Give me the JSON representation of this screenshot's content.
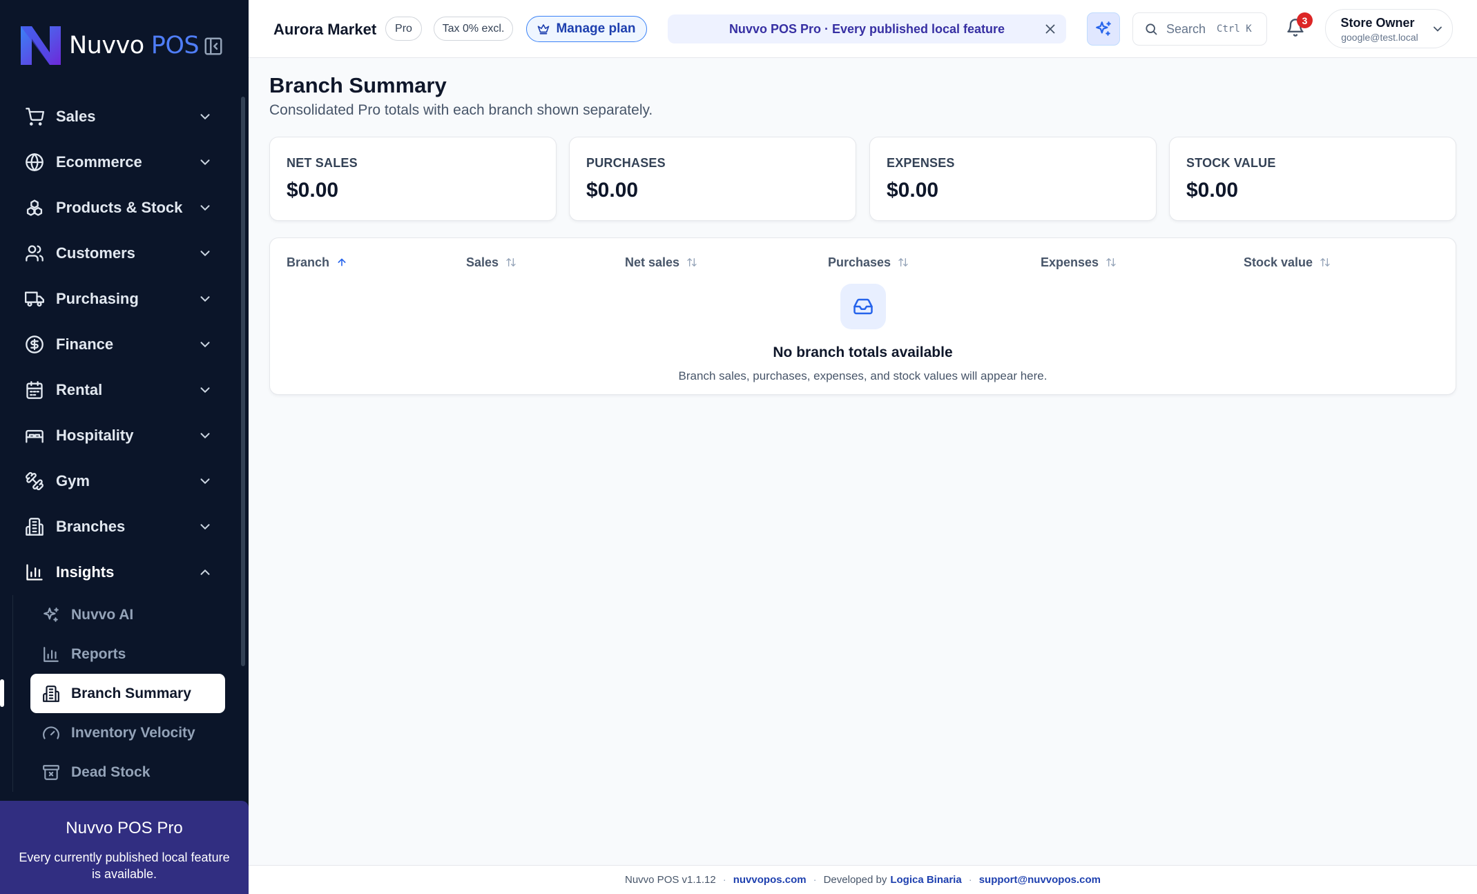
{
  "sidebar": {
    "logo": {
      "word1": "Nuvvo",
      "word2": "POS"
    },
    "collapse_icon": "panel-left-icon",
    "nav": [
      {
        "label": "Sales",
        "icon": "cart-icon"
      },
      {
        "label": "Ecommerce",
        "icon": "globe-icon"
      },
      {
        "label": "Products & Stock",
        "icon": "boxes-icon"
      },
      {
        "label": "Customers",
        "icon": "users-icon"
      },
      {
        "label": "Purchasing",
        "icon": "truck-icon"
      },
      {
        "label": "Finance",
        "icon": "dollar-circle-icon"
      },
      {
        "label": "Rental",
        "icon": "calendar-icon"
      },
      {
        "label": "Hospitality",
        "icon": "bed-icon"
      },
      {
        "label": "Gym",
        "icon": "dumbbell-icon"
      },
      {
        "label": "Branches",
        "icon": "building-icon"
      },
      {
        "label": "Insights",
        "icon": "bar-chart-icon"
      }
    ],
    "insights_sub": [
      {
        "label": "Nuvvo AI",
        "icon": "sparkles-icon"
      },
      {
        "label": "Reports",
        "icon": "bar-chart-icon"
      },
      {
        "label": "Branch Summary",
        "icon": "building-icon"
      },
      {
        "label": "Inventory Velocity",
        "icon": "gauge-icon"
      },
      {
        "label": "Dead Stock",
        "icon": "archive-x-icon"
      }
    ],
    "pro_card": {
      "title": "Nuvvo POS Pro",
      "desc": "Every currently published local feature is available."
    }
  },
  "topbar": {
    "store_name": "Aurora Market",
    "plan_badge": "Pro",
    "tax_badge": "Tax 0% excl.",
    "manage_plan": "Manage plan",
    "banner": "Nuvvo POS Pro · Every published local feature",
    "search_placeholder": "Search",
    "search_shortcut": "Ctrl K",
    "notifications_count": "3",
    "user_name": "Store Owner",
    "user_email": "google@test.local"
  },
  "page": {
    "title": "Branch Summary",
    "subtitle": "Consolidated Pro totals with each branch shown separately."
  },
  "stats": [
    {
      "label": "NET SALES",
      "value": "$0.00"
    },
    {
      "label": "PURCHASES",
      "value": "$0.00"
    },
    {
      "label": "EXPENSES",
      "value": "$0.00"
    },
    {
      "label": "STOCK VALUE",
      "value": "$0.00"
    }
  ],
  "table": {
    "columns": [
      "Branch",
      "Sales",
      "Net sales",
      "Purchases",
      "Expenses",
      "Stock value"
    ],
    "sorted_column": "Branch",
    "empty_title": "No branch totals available",
    "empty_desc": "Branch sales, purchases, expenses, and stock values will appear here."
  },
  "footer": {
    "version": "Nuvvo POS v1.1.12",
    "site": "nuvvopos.com",
    "developed_by": "Developed by",
    "developer": "Logica Binaria",
    "email": "support@nuvvopos.com"
  },
  "colors": {
    "sidebar_bg": "#0b1529",
    "accent": "#2563eb",
    "pro_card_bg": "#312e81",
    "badge_red": "#dc2626"
  }
}
